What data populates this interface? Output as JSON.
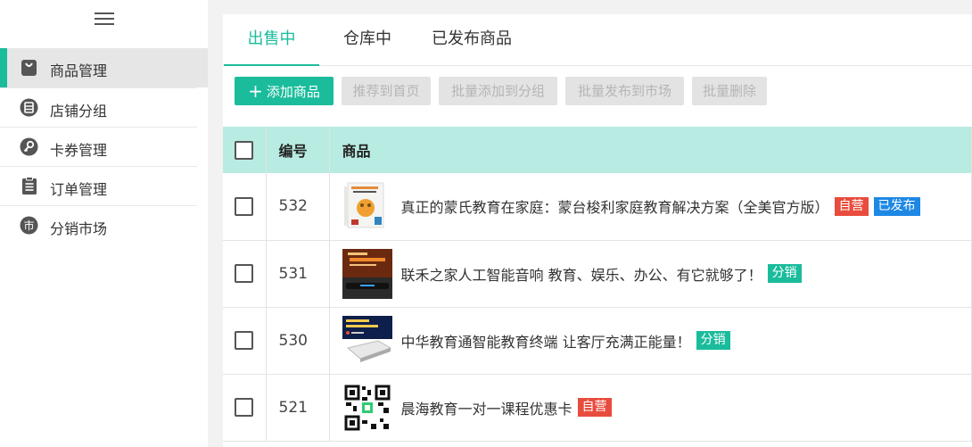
{
  "sidebar": {
    "items": [
      {
        "label": "商品管理",
        "icon": "bag-icon",
        "active": true
      },
      {
        "label": "店铺分组",
        "icon": "list-circle-icon",
        "active": false
      },
      {
        "label": "卡券管理",
        "icon": "key-circle-icon",
        "active": false
      },
      {
        "label": "订单管理",
        "icon": "clipboard-icon",
        "active": false
      },
      {
        "label": "分销市场",
        "icon": "market-circle-icon",
        "active": false
      }
    ],
    "market_glyph": "市"
  },
  "tabs": [
    {
      "label": "出售中",
      "active": true
    },
    {
      "label": "仓库中",
      "active": false
    },
    {
      "label": "已发布商品",
      "active": false
    }
  ],
  "toolbar": {
    "add_label": "添加商品",
    "recommend_label": "推荐到首页",
    "batch_group_label": "批量添加到分组",
    "batch_publish_label": "批量发布到市场",
    "batch_delete_label": "批量删除"
  },
  "table": {
    "headers": {
      "id": "编号",
      "product": "商品"
    },
    "rows": [
      {
        "id": "532",
        "name": "真正的蒙氏教育在家庭：蒙台梭利家庭教育解决方案（全美官方版）",
        "tags": [
          {
            "text": "自营",
            "color": "#e84c3d"
          },
          {
            "text": "已发布",
            "color": "#1e88e5"
          }
        ],
        "thumb": "book-cover-image"
      },
      {
        "id": "531",
        "name": "联禾之家人工智能音响 教育、娱乐、办公、有它就够了！",
        "tags": [
          {
            "text": "分销",
            "color": "#1abc9c"
          }
        ],
        "thumb": "smart-speaker-image"
      },
      {
        "id": "530",
        "name": "中华教育通智能教育终端 让客厅充满正能量！",
        "tags": [
          {
            "text": "分销",
            "color": "#1abc9c"
          }
        ],
        "thumb": "tv-box-image"
      },
      {
        "id": "521",
        "name": "晨海教育一对一课程优惠卡",
        "tags": [
          {
            "text": "自营",
            "color": "#e84c3d"
          }
        ],
        "thumb": "qr-code-image"
      }
    ]
  },
  "colors": {
    "accent": "#1abc9c",
    "header_bg": "#b8ebe1",
    "self_tag": "#e84c3d",
    "published_tag": "#1e88e5"
  }
}
